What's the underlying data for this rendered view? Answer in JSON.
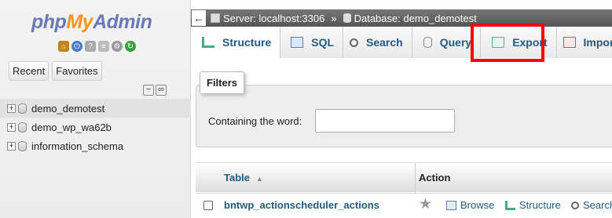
{
  "nav": {
    "logo": {
      "php": "php",
      "my": "My",
      "admin": "Admin"
    },
    "icons": [
      "home-icon",
      "logout-icon",
      "docs-icon",
      "sql-docs-icon",
      "gear-icon",
      "reload-icon"
    ],
    "tabs": [
      "Recent",
      "Favorites"
    ],
    "databases": [
      "demo_demotest",
      "demo_wp_wa62b",
      "information_schema"
    ]
  },
  "breadcrumb": {
    "back": "←",
    "server": "Server: localhost:3306",
    "separator": "»",
    "database": "Database: demo_demotest"
  },
  "menu": {
    "tabs": [
      {
        "label": "Structure",
        "icon": "structure-icon"
      },
      {
        "label": "SQL",
        "icon": "sql-icon"
      },
      {
        "label": "Search",
        "icon": "search-icon"
      },
      {
        "label": "Query",
        "icon": "query-icon"
      },
      {
        "label": "Export",
        "icon": "export-icon"
      },
      {
        "label": "Import",
        "icon": "import-icon"
      }
    ]
  },
  "filters": {
    "legend": "Filters",
    "label": "Containing the word:",
    "value": ""
  },
  "table": {
    "headers": {
      "table": "Table",
      "sort_glyph": "▲",
      "action": "Action"
    },
    "rows": [
      {
        "name": "bntwp_actionscheduler_actions",
        "star": "★",
        "actions": [
          "Browse",
          "Structure",
          "Search"
        ]
      }
    ]
  },
  "colors": {
    "link": "#235a81",
    "highlight": "#ff0000",
    "logo_orange": "#f7931e",
    "logo_blue": "#6c78b8"
  }
}
